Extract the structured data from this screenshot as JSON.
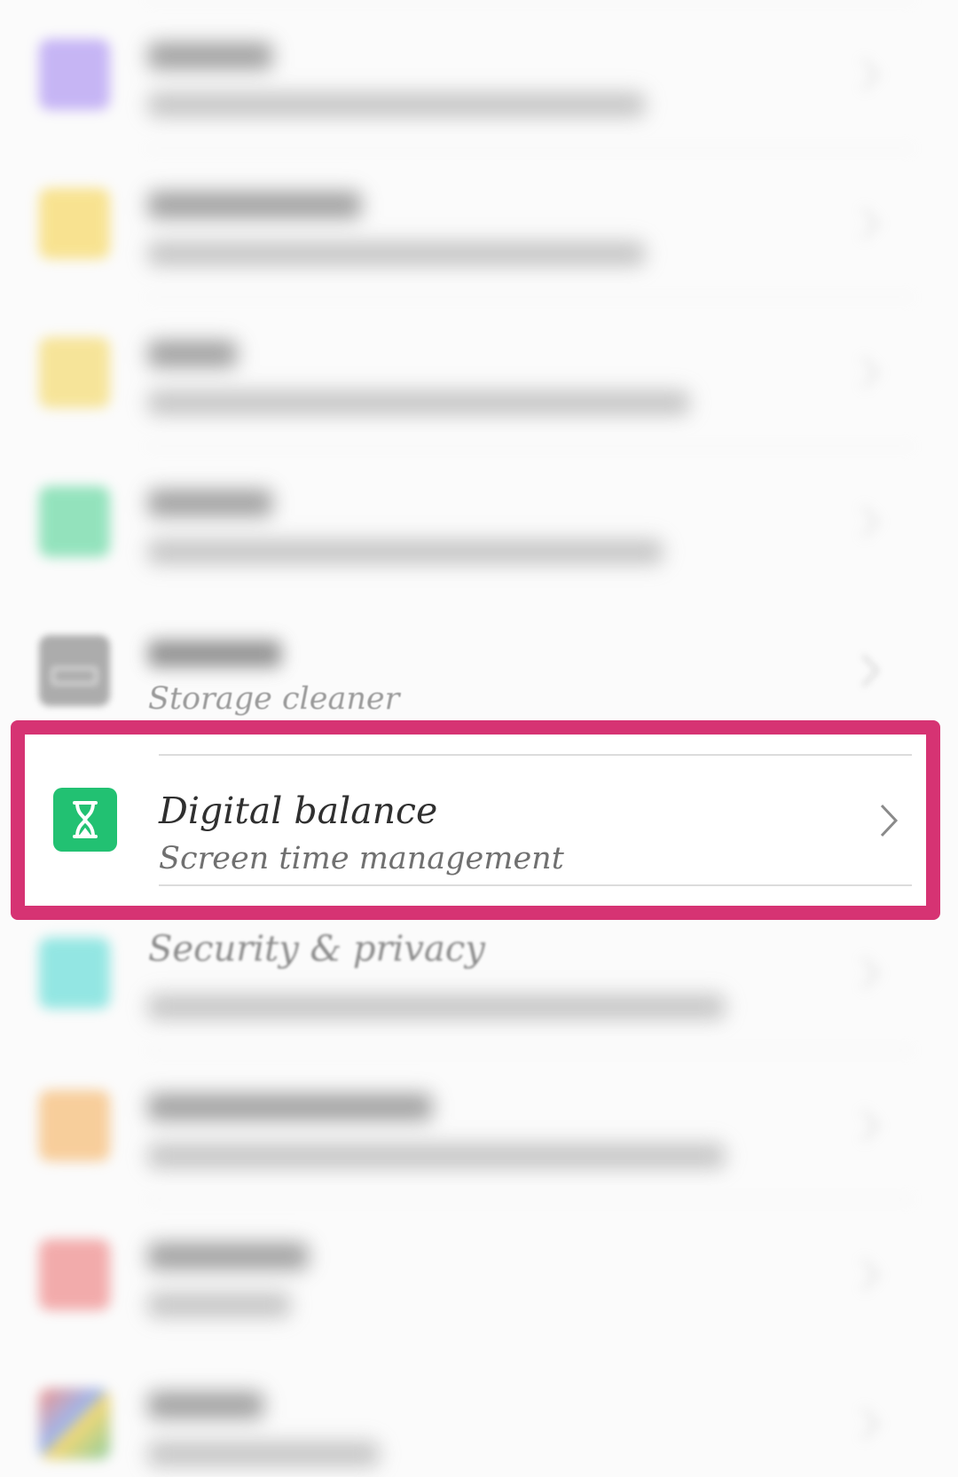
{
  "colors": {
    "highlight_border": "#d63373",
    "digital_balance_icon_bg": "#22c172",
    "sounds_icon": "#9b7cf0",
    "notifications_icon": "#f6cf3a",
    "apps_icon": "#f3d24a",
    "battery_icon": "#3fcf8a",
    "storage_icon": "#8a8a8a",
    "security_icon": "#3fd6cf",
    "smart_assistance_icon": "#f5a94d",
    "accounts_icon": "#ec6b6b"
  },
  "settings": {
    "storage": {
      "subtitle": "Storage cleaner",
      "icon": "storage-icon"
    },
    "digital_balance": {
      "title": "Digital balance",
      "subtitle": "Screen time management",
      "icon": "hourglass-icon"
    },
    "security": {
      "title": "Security & privacy",
      "icon": "shield-icon"
    }
  }
}
